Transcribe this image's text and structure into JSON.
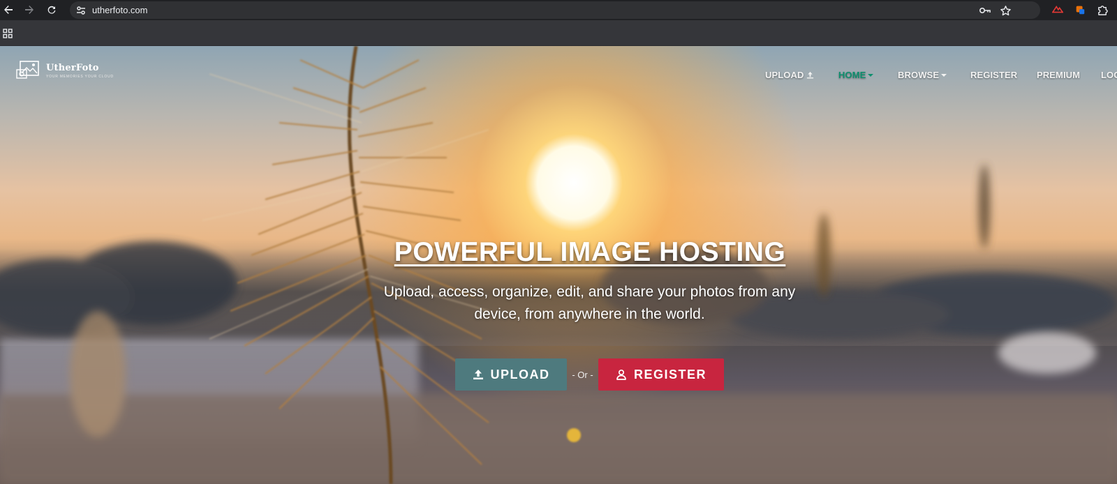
{
  "browser": {
    "url": "utherfoto.com",
    "icons": [
      "back-icon",
      "forward-icon",
      "reload-icon",
      "site-info-icon",
      "password-key-icon",
      "bookmark-star-icon",
      "extension-red-icon",
      "extension-badge-icon",
      "extensions-puzzle-icon",
      "apps-grid-icon"
    ]
  },
  "site": {
    "logo_name": "UtherFoto",
    "logo_tagline": "YOUR MEMORIES YOUR CLOUD"
  },
  "nav": {
    "upload": "UPLOAD",
    "home": "HOME",
    "browse": "BROWSE",
    "register": "REGISTER",
    "premium": "PREMIUM",
    "login": "LOG"
  },
  "hero": {
    "title": "POWERFUL IMAGE HOSTING",
    "subtitle": "Upload, access, organize, edit, and share your photos from any device, from anywhere in the world.",
    "upload_button": "UPLOAD",
    "or_text": "- Or -",
    "register_button": "REGISTER"
  },
  "colors": {
    "active_nav": "#0e8f6e",
    "upload_button": "#4e7a7e",
    "register_button": "#c8253f"
  }
}
